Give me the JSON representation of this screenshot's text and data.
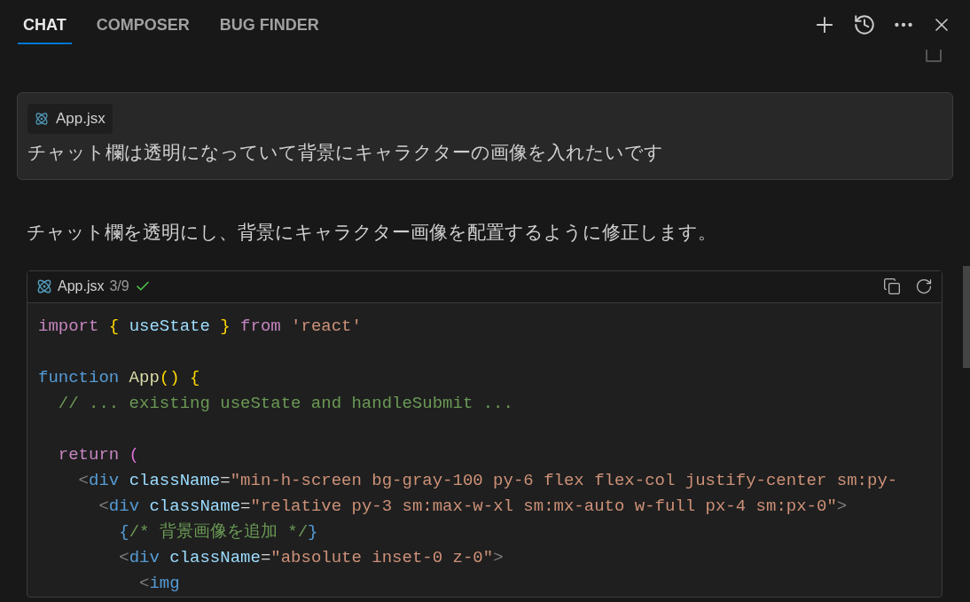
{
  "tabs": [
    {
      "label": "CHAT",
      "selected": true
    },
    {
      "label": "COMPOSER",
      "selected": false
    },
    {
      "label": "BUG FINDER",
      "selected": false
    }
  ],
  "user_message": {
    "file_chip": "App.jsx",
    "text": "チャット欄は透明になっていて背景にキャラクターの画像を入れたいです"
  },
  "reply": {
    "text": "チャット欄を透明にし、背景にキャラクター画像を配置するように修正します。"
  },
  "code_block": {
    "file": "App.jsx",
    "version": "3/9",
    "applied": true,
    "lines": [
      {
        "tokens": [
          {
            "kind": "keyword",
            "text": "import"
          },
          {
            "kind": "brace",
            "text": " {"
          },
          {
            "kind": "var",
            "text": " useState "
          },
          {
            "kind": "brace",
            "text": "}"
          },
          {
            "kind": "keyword",
            "text": " from"
          },
          {
            "kind": "string",
            "text": " 'react'"
          }
        ]
      },
      {
        "kind": "blank"
      },
      {
        "tokens": [
          {
            "kind": "storage",
            "text": "function"
          },
          {
            "kind": "func",
            "text": " App"
          },
          {
            "kind": "brace",
            "text": "() {"
          }
        ]
      },
      {
        "tokens": [
          {
            "kind": "comment",
            "text": "  // ... existing useState and handleSubmit ..."
          }
        ]
      },
      {
        "kind": "blank"
      },
      {
        "tokens": [
          {
            "kind": "keyword",
            "text": "  return"
          },
          {
            "kind": "paren",
            "text": " ("
          }
        ]
      },
      {
        "tokens": [
          {
            "kind": "punct",
            "text": "    <"
          },
          {
            "kind": "tag",
            "text": "div"
          },
          {
            "kind": "var",
            "text": " className"
          },
          {
            "kind": "plain",
            "text": "="
          },
          {
            "kind": "string",
            "text": "\"min-h-screen bg-gray-100 py-6 flex flex-col justify-center sm:py-"
          }
        ]
      },
      {
        "tokens": [
          {
            "kind": "punct",
            "text": "      <"
          },
          {
            "kind": "tag",
            "text": "div"
          },
          {
            "kind": "var",
            "text": " className"
          },
          {
            "kind": "plain",
            "text": "="
          },
          {
            "kind": "string",
            "text": "\"relative py-3 sm:max-w-xl sm:mx-auto w-full px-4 sm:px-0\""
          },
          {
            "kind": "punct",
            "text": ">"
          }
        ]
      },
      {
        "tokens": [
          {
            "kind": "tag",
            "text": "        {"
          },
          {
            "kind": "comment",
            "text": "/* 背景画像を追加 */"
          },
          {
            "kind": "tag",
            "text": "}"
          }
        ]
      },
      {
        "tokens": [
          {
            "kind": "punct",
            "text": "        <"
          },
          {
            "kind": "tag",
            "text": "div"
          },
          {
            "kind": "var",
            "text": " className"
          },
          {
            "kind": "plain",
            "text": "="
          },
          {
            "kind": "string",
            "text": "\"absolute inset-0 z-0\""
          },
          {
            "kind": "punct",
            "text": ">"
          }
        ]
      },
      {
        "tokens": [
          {
            "kind": "punct",
            "text": "          <"
          },
          {
            "kind": "tag",
            "text": "img"
          }
        ]
      }
    ]
  }
}
